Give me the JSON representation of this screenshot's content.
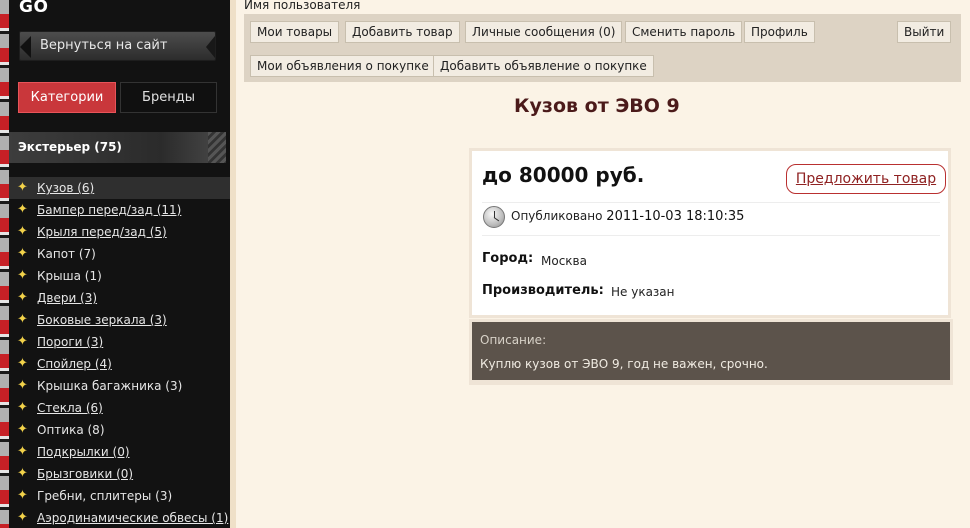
{
  "sidebar": {
    "brand": "GO",
    "back_label": "Вернуться на сайт",
    "tabs": {
      "categories": "Категории",
      "brands": "Бренды"
    },
    "section_title": "Экстерьер (75)",
    "items": [
      {
        "label": "Кузов (6)",
        "link": true,
        "active": true
      },
      {
        "label": "Бампер перед/зад (11)",
        "link": true
      },
      {
        "label": "Крыля перед/зад (5)",
        "link": true
      },
      {
        "label": "Капот (7)",
        "link": false
      },
      {
        "label": "Крыша (1)",
        "link": false
      },
      {
        "label": "Двери (3)",
        "link": true
      },
      {
        "label": "Боковые зеркала (3)",
        "link": true
      },
      {
        "label": "Пороги (3)",
        "link": true
      },
      {
        "label": "Спойлер (4)",
        "link": true
      },
      {
        "label": "Крышка багажника (3)",
        "link": false
      },
      {
        "label": "Стекла (6)",
        "link": true
      },
      {
        "label": "Оптика (8)",
        "link": false
      },
      {
        "label": "Подкрылки (0)",
        "link": true
      },
      {
        "label": "Брызговики (0)",
        "link": true
      },
      {
        "label": "Гребни, сплитеры (3)",
        "link": false
      },
      {
        "label": "Аэродинамические обвесы (1)",
        "link": true
      }
    ]
  },
  "header": {
    "username": "Имя пользователя",
    "buttons": {
      "my_goods": "Мои товары",
      "add_good": "Добавить товар",
      "messages": "Личные сообщения (0)",
      "change_password": "Сменить пароль",
      "profile": "Профиль",
      "logout": "Выйти",
      "my_ads": "Мои объявления о покупке",
      "add_ad": "Добавить объявление о покупке"
    }
  },
  "listing": {
    "title": "Кузов от ЭВО 9",
    "price": "до 80000 руб.",
    "offer_button": "Предложить товар",
    "published_label": "Опубликовано",
    "published_date": "2011-10-03 18:10:35",
    "city_label": "Город:",
    "city_value": "Москва",
    "maker_label": "Производитель:",
    "maker_value": "Не указан",
    "description_label": "Описание:",
    "description_text": "Куплю кузов от ЭВО 9, год не важен, срочно."
  },
  "colors": {
    "sidebar_bg": "#121212",
    "accent_red": "#c9373b",
    "title": "#4b1a1a",
    "page_bg": "#fbf3e6"
  }
}
